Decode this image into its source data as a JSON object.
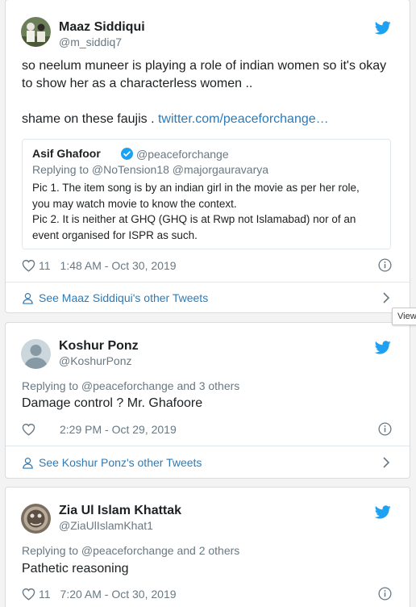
{
  "colors": {
    "link": "#2b7bb9",
    "muted": "#697882",
    "twitter_blue": "#1da1f2",
    "text": "#1c2022"
  },
  "tweets": [
    {
      "author_name": "Maaz Siddiqui",
      "handle": "@m_siddiq7",
      "text_line1": "so neelum muneer is playing a role of indian women so it's okay",
      "text_line2": "to show her as a characterless  women ..",
      "text_line3": "shame on these faujis . ",
      "link_text": "twitter.com/peaceforchange…",
      "quoted": {
        "author_name": "Asif Ghafoor",
        "handle": "@peaceforchange",
        "replying": "Replying to @NoTension18 @majorgauravarya",
        "line1": "Pic 1. The item song is by an indian girl in the movie as per her role,",
        "line2": "you may watch movie to know the context.",
        "line3": "Pic 2. It is neither at GHQ (GHQ is at Rwp not Islamabad) nor of an",
        "line4": "event organised for ISPR as such."
      },
      "likes": "11",
      "timestamp": "1:48 AM - Oct 30, 2019",
      "see_other": "See Maaz Siddiqui's other Tweets"
    },
    {
      "author_name": "Koshur Ponz",
      "handle": "@KoshurPonz",
      "replying": "Replying to @peaceforchange and 3 others",
      "text": "Damage control ? Mr. Ghafoore",
      "likes": "",
      "timestamp": "2:29 PM - Oct 29, 2019",
      "see_other": "See Koshur Ponz's other Tweets"
    },
    {
      "author_name": "Zia Ul Islam Khattak",
      "handle": "@ZiaUlIslamKhat1",
      "replying": "Replying to @peaceforchange and 2 others",
      "text": "Pathetic reasoning",
      "likes": "11",
      "timestamp": "7:20 AM - Oct 30, 2019"
    }
  ],
  "tooltip": "View"
}
